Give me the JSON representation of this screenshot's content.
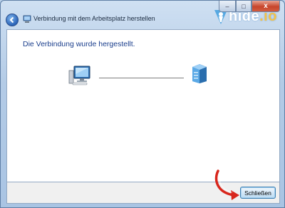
{
  "window": {
    "title": "Verbindung mit dem Arbeitsplatz herstellen",
    "controls": {
      "minimize": "–",
      "maximize": "□",
      "close": "x"
    }
  },
  "brand": {
    "name": "hide",
    "suffix": ".io"
  },
  "main": {
    "heading": "Die Verbindung wurde hergestellt."
  },
  "footer": {
    "close_label": "Schließen"
  },
  "colors": {
    "heading": "#1a3e8c",
    "annotation_arrow": "#d8261c",
    "brand_dot": "#f3c24a"
  }
}
